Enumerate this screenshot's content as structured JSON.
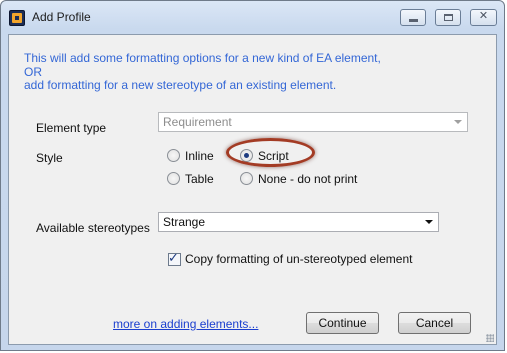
{
  "window": {
    "title": "Add Profile",
    "close_glyph": "✕"
  },
  "intro": {
    "line1": "This will add some formatting options for a new kind of EA element,",
    "line2": "OR",
    "line3": "add formatting for a new stereotype of an existing element."
  },
  "element_type": {
    "label": "Element type",
    "value": "Requirement",
    "enabled": false
  },
  "style": {
    "label": "Style",
    "options": [
      {
        "label": "Inline",
        "selected": false
      },
      {
        "label": "Script",
        "selected": true
      },
      {
        "label": "Table",
        "selected": false
      },
      {
        "label": "None - do not print",
        "selected": false
      }
    ]
  },
  "stereotypes": {
    "label": "Available stereotypes",
    "value": "Strange"
  },
  "copy_formatting": {
    "label": "Copy formatting of un-stereotyped element",
    "checked": true,
    "check_glyph": "✓"
  },
  "footer": {
    "link": "more on adding elements...",
    "continue_label": "Continue",
    "cancel_label": "Cancel"
  },
  "colors": {
    "intro_text": "#3467d6",
    "link": "#1b3fcf",
    "highlight_ring": "#a33b24"
  }
}
